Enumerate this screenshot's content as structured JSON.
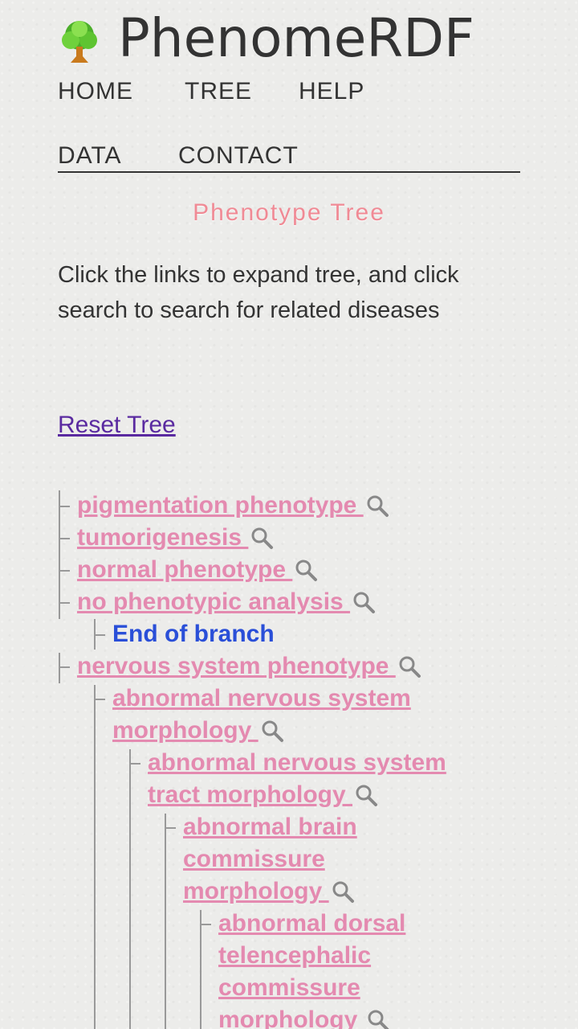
{
  "site": {
    "title": "PhenomeRDF"
  },
  "nav": [
    {
      "label": "HOME"
    },
    {
      "label": "TREE"
    },
    {
      "label": "HELP"
    },
    {
      "label": "DATA"
    },
    {
      "label": "CONTACT"
    }
  ],
  "page": {
    "title": "Phenotype Tree",
    "intro": "Click the links to expand tree, and click search to search for related diseases",
    "reset_label": "Reset Tree "
  },
  "tree": [
    {
      "label": "pigmentation phenotype "
    },
    {
      "label": "tumorigenesis "
    },
    {
      "label": "normal phenotype "
    },
    {
      "label": "no phenotypic analysis "
    },
    {
      "label": "End of branch"
    },
    {
      "label": "nervous system phenotype "
    },
    {
      "label": "abnormal nervous system morphology "
    },
    {
      "label": "abnormal nervous system tract morphology "
    },
    {
      "label": "abnormal brain commissure morphology "
    },
    {
      "label": "abnormal dorsal telencephalic commissure morphology "
    }
  ],
  "colors": {
    "link": "#e48ab0",
    "end_of_branch": "#2a4fd8",
    "title": "#f08a95",
    "reset": "#5a2aa0"
  }
}
